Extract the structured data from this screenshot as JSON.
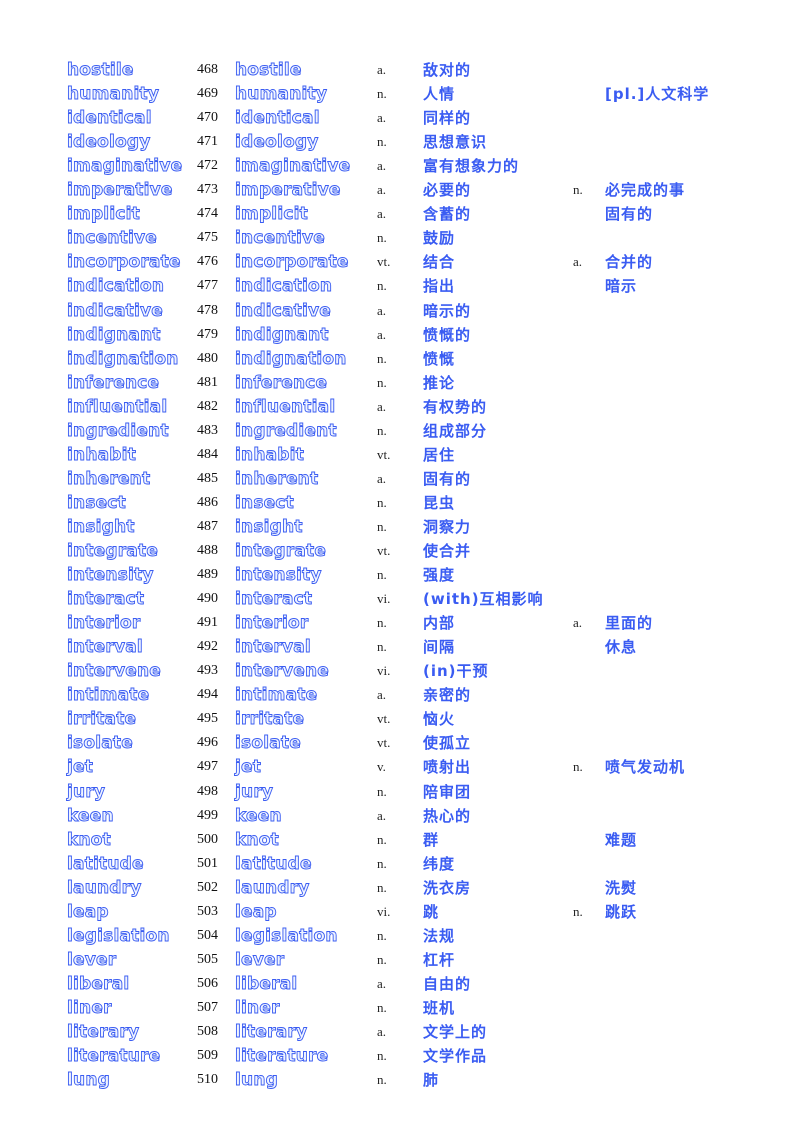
{
  "entries": [
    {
      "word": "hostile",
      "num": "468",
      "pos1": "a.",
      "def1": "敌对的",
      "pos2": "",
      "def2": ""
    },
    {
      "word": "humanity",
      "num": "469",
      "pos1": "n.",
      "def1": "人情",
      "pos2": "",
      "def2": "[pl.]人文科学"
    },
    {
      "word": "identical",
      "num": "470",
      "pos1": "a.",
      "def1": "同样的",
      "pos2": "",
      "def2": ""
    },
    {
      "word": "ideology",
      "num": "471",
      "pos1": "n.",
      "def1": "思想意识",
      "pos2": "",
      "def2": ""
    },
    {
      "word": "imaginative",
      "num": "472",
      "pos1": "a.",
      "def1": "富有想象力的",
      "pos2": "",
      "def2": ""
    },
    {
      "word": "imperative",
      "num": "473",
      "pos1": "a.",
      "def1": "必要的",
      "pos2": "n.",
      "def2": "必完成的事"
    },
    {
      "word": "implicit",
      "num": "474",
      "pos1": "a.",
      "def1": "含蓄的",
      "pos2": "",
      "def2": "固有的"
    },
    {
      "word": "incentive",
      "num": "475",
      "pos1": "n.",
      "def1": "鼓励",
      "pos2": "",
      "def2": ""
    },
    {
      "word": "incorporate",
      "num": "476",
      "pos1": "vt.",
      "def1": "结合",
      "pos2": "a.",
      "def2": "合并的"
    },
    {
      "word": "indication",
      "num": "477",
      "pos1": "n.",
      "def1": "指出",
      "pos2": "",
      "def2": "暗示"
    },
    {
      "word": "indicative",
      "num": "478",
      "pos1": "a.",
      "def1": "暗示的",
      "pos2": "",
      "def2": ""
    },
    {
      "word": "indignant",
      "num": "479",
      "pos1": "a.",
      "def1": "愤慨的",
      "pos2": "",
      "def2": ""
    },
    {
      "word": "indignation",
      "num": "480",
      "pos1": "n.",
      "def1": "愤慨",
      "pos2": "",
      "def2": ""
    },
    {
      "word": "inference",
      "num": "481",
      "pos1": "n.",
      "def1": "推论",
      "pos2": "",
      "def2": ""
    },
    {
      "word": "influential",
      "num": "482",
      "pos1": "a.",
      "def1": "有权势的",
      "pos2": "",
      "def2": ""
    },
    {
      "word": "ingredient",
      "num": "483",
      "pos1": "n.",
      "def1": "组成部分",
      "pos2": "",
      "def2": ""
    },
    {
      "word": "inhabit",
      "num": "484",
      "pos1": "vt.",
      "def1": "居住",
      "pos2": "",
      "def2": ""
    },
    {
      "word": "inherent",
      "num": "485",
      "pos1": "a.",
      "def1": "固有的",
      "pos2": "",
      "def2": ""
    },
    {
      "word": "insect",
      "num": "486",
      "pos1": "n.",
      "def1": "昆虫",
      "pos2": "",
      "def2": ""
    },
    {
      "word": "insight",
      "num": "487",
      "pos1": "n.",
      "def1": "洞察力",
      "pos2": "",
      "def2": ""
    },
    {
      "word": "integrate",
      "num": "488",
      "pos1": "vt.",
      "def1": "使合并",
      "pos2": "",
      "def2": ""
    },
    {
      "word": "intensity",
      "num": "489",
      "pos1": "n.",
      "def1": "强度",
      "pos2": "",
      "def2": ""
    },
    {
      "word": "interact",
      "num": "490",
      "pos1": "vi.",
      "def1": "(with)互相影响",
      "pos2": "",
      "def2": ""
    },
    {
      "word": "interior",
      "num": "491",
      "pos1": "n.",
      "def1": "内部",
      "pos2": "a.",
      "def2": "里面的"
    },
    {
      "word": "interval",
      "num": "492",
      "pos1": "n.",
      "def1": "间隔",
      "pos2": "",
      "def2": "休息"
    },
    {
      "word": "intervene",
      "num": "493",
      "pos1": "vi.",
      "def1": "(in)干预",
      "pos2": "",
      "def2": ""
    },
    {
      "word": "intimate",
      "num": "494",
      "pos1": "a.",
      "def1": "亲密的",
      "pos2": "",
      "def2": ""
    },
    {
      "word": "irritate",
      "num": "495",
      "pos1": "vt.",
      "def1": "恼火",
      "pos2": "",
      "def2": ""
    },
    {
      "word": "isolate",
      "num": "496",
      "pos1": "vt.",
      "def1": "使孤立",
      "pos2": "",
      "def2": ""
    },
    {
      "word": "jet",
      "num": "497",
      "pos1": "v.",
      "def1": "喷射出",
      "pos2": "n.",
      "def2": "喷气发动机"
    },
    {
      "word": "jury",
      "num": "498",
      "pos1": "n.",
      "def1": "陪审团",
      "pos2": "",
      "def2": ""
    },
    {
      "word": "keen",
      "num": "499",
      "pos1": "a.",
      "def1": "热心的",
      "pos2": "",
      "def2": ""
    },
    {
      "word": "knot",
      "num": "500",
      "pos1": "n.",
      "def1": "群",
      "pos2": "",
      "def2": "难题"
    },
    {
      "word": "latitude",
      "num": "501",
      "pos1": "n.",
      "def1": "纬度",
      "pos2": "",
      "def2": ""
    },
    {
      "word": "laundry",
      "num": "502",
      "pos1": "n.",
      "def1": "洗衣房",
      "pos2": "",
      "def2": "洗熨"
    },
    {
      "word": "leap",
      "num": "503",
      "pos1": "vi.",
      "def1": "跳",
      "pos2": "n.",
      "def2": "跳跃"
    },
    {
      "word": "legislation",
      "num": "504",
      "pos1": "n.",
      "def1": "法规",
      "pos2": "",
      "def2": ""
    },
    {
      "word": "lever",
      "num": "505",
      "pos1": "n.",
      "def1": "杠杆",
      "pos2": "",
      "def2": ""
    },
    {
      "word": "liberal",
      "num": "506",
      "pos1": "a.",
      "def1": "自由的",
      "pos2": "",
      "def2": ""
    },
    {
      "word": "liner",
      "num": "507",
      "pos1": "n.",
      "def1": "班机",
      "pos2": "",
      "def2": ""
    },
    {
      "word": "literary",
      "num": "508",
      "pos1": "a.",
      "def1": "文学上的",
      "pos2": "",
      "def2": ""
    },
    {
      "word": "literature",
      "num": "509",
      "pos1": "n.",
      "def1": "文学作品",
      "pos2": "",
      "def2": ""
    },
    {
      "word": "lung",
      "num": "510",
      "pos1": "n.",
      "def1": "肺",
      "pos2": "",
      "def2": ""
    }
  ]
}
